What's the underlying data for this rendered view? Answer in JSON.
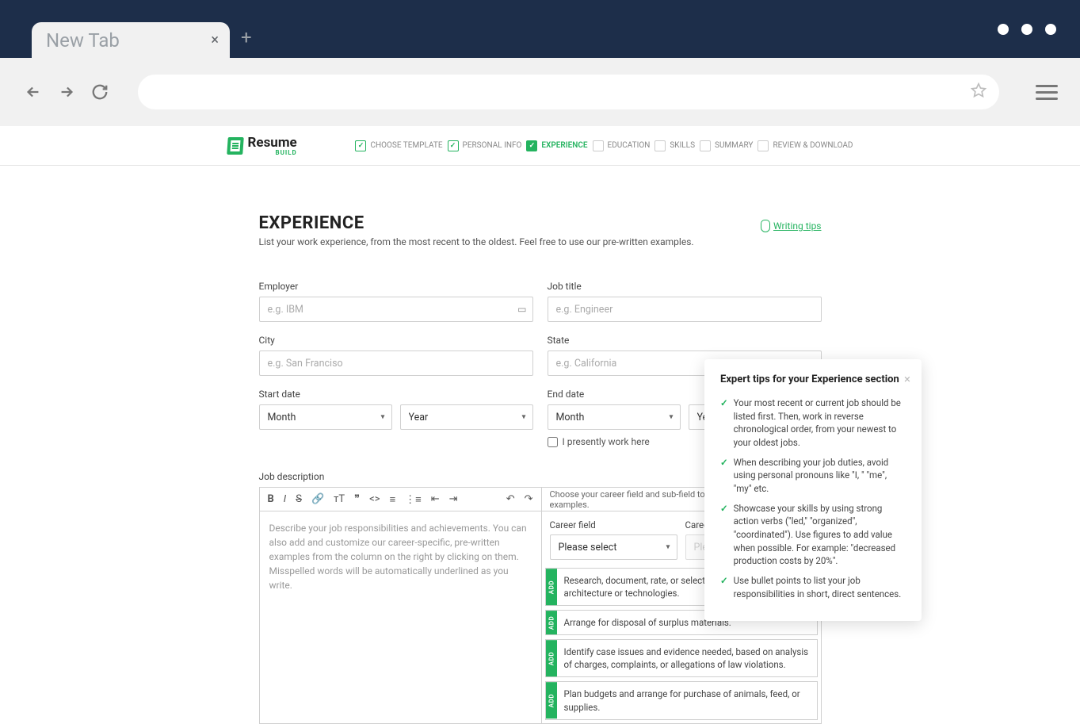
{
  "browser": {
    "tab_title": "New Tab"
  },
  "logo": {
    "name": "Resume",
    "sub": "BUILD"
  },
  "steps": [
    {
      "label": "CHOOSE TEMPLATE",
      "state": "done"
    },
    {
      "label": "PERSONAL INFO",
      "state": "done"
    },
    {
      "label": "EXPERIENCE",
      "state": "active"
    },
    {
      "label": "EDUCATION",
      "state": ""
    },
    {
      "label": "SKILLS",
      "state": ""
    },
    {
      "label": "SUMMARY",
      "state": ""
    },
    {
      "label": "REVIEW & DOWNLOAD",
      "state": ""
    }
  ],
  "page_title": "EXPERIENCE",
  "page_subtitle": "List your work experience, from the most recent to the oldest. Feel free to use our pre-written examples.",
  "tips_link": "Writing tips",
  "form": {
    "employer_label": "Employer",
    "employer_ph": "e.g. IBM",
    "job_title_label": "Job title",
    "job_title_ph": "e.g. Engineer",
    "city_label": "City",
    "city_ph": "e.g. San Franciso",
    "state_label": "State",
    "state_ph": "e.g. California",
    "start_label": "Start date",
    "end_label": "End date",
    "month_ph": "Month",
    "year_ph": "Year",
    "presently_label": "I presently work here"
  },
  "desc": {
    "label": "Job description",
    "placeholder": "Describe your job responsibilities and achievements. You can also add and customize our career-specific, pre-written examples from the column on the right by clicking on them. Misspelled words will be automatically underlined as you write.",
    "examples_hint": "Choose your career field and sub-field to find relevant pre-written examples.",
    "career_field_label": "Career field",
    "career_subfield_label": "Career subfield",
    "please_select": "Please select",
    "add_label": "ADD",
    "examples": [
      "Research, document, rate, or select alternatives for web architecture or technologies.",
      "Arrange for disposal of surplus materials.",
      "Identify case issues and evidence needed, based on analysis of charges, complaints, or allegations of law violations.",
      "Plan budgets and arrange for purchase of animals, feed, or supplies."
    ]
  },
  "tips": {
    "title": "Expert tips for your Experience section",
    "items": [
      "Your most recent or current job should be listed first. Then, work in reverse chronological order, from your newest to your oldest jobs.",
      "When describing your job duties, avoid using personal pronouns like \"I, \" \"me\", \"my\" etc.",
      "Showcase your skills by using strong action verbs (\"led,\" \"organized\", \"coordinated\"). Use figures to add value when possible. For example: \"decreased production costs by 20%\".",
      "Use bullet points to list your job responsibilities in short, direct sentences."
    ]
  }
}
